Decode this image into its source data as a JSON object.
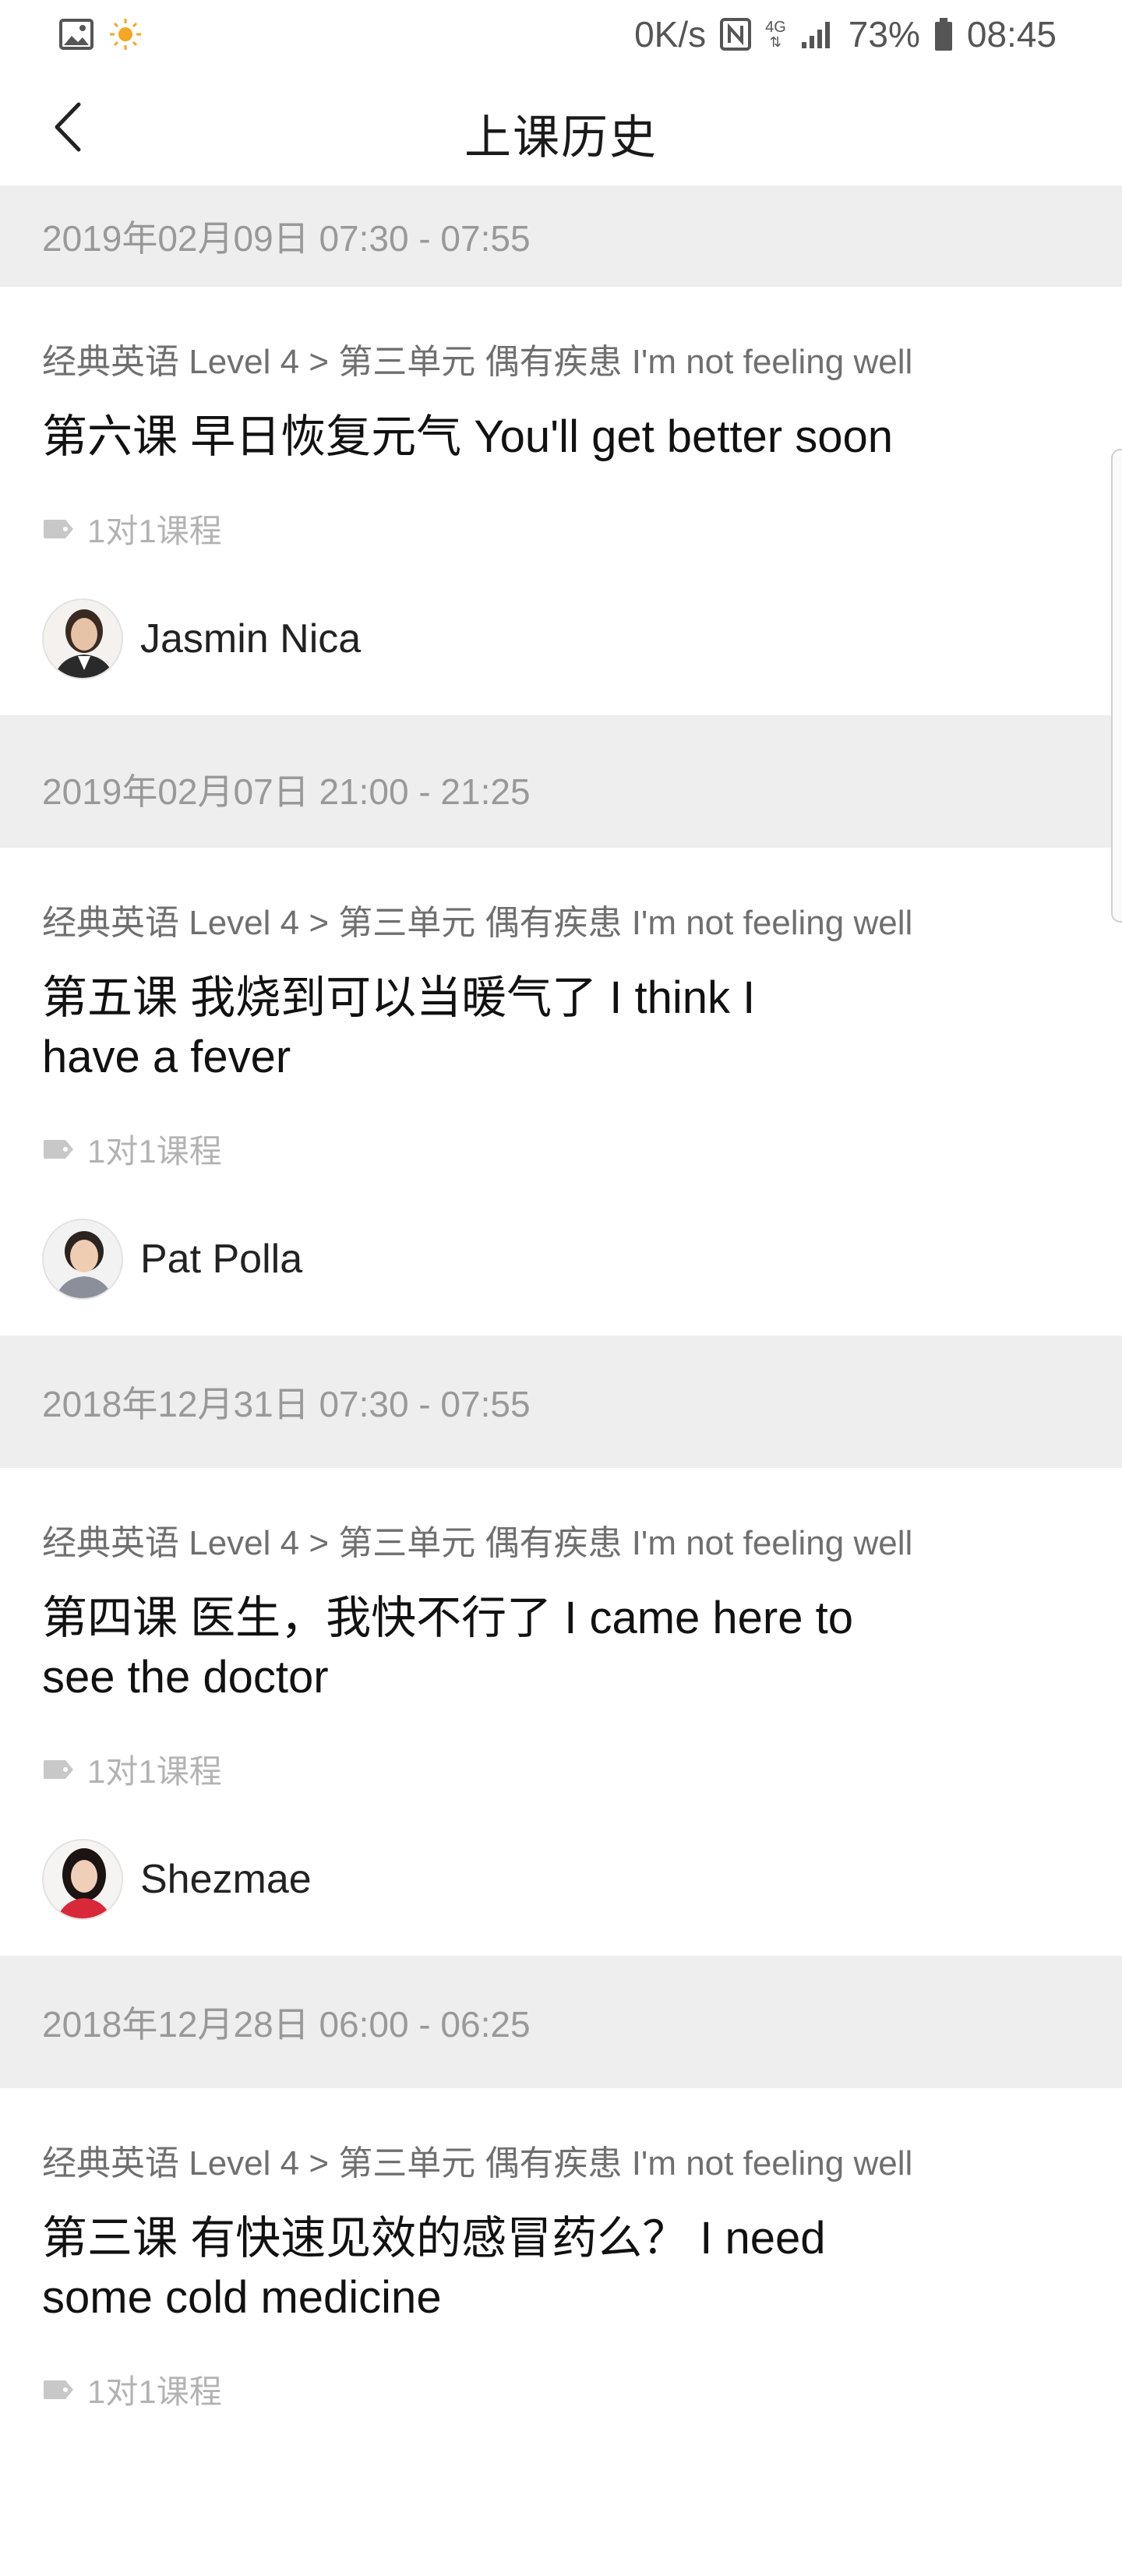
{
  "status_bar": {
    "net_speed": "0K/s",
    "network": "4G",
    "battery": "73%",
    "time": "08:45"
  },
  "header": {
    "title": "上课历史"
  },
  "sessions": [
    {
      "date": "2019年02月09日 07:30 - 07:55",
      "breadcrumb": "经典英语 Level 4 > 第三单元 偶有疾患 I'm not feeling well",
      "lesson_line1": "第六课 早日恢复元气 You'll get better soon",
      "lesson_line2": "",
      "tag": "1对1课程",
      "teacher": "Jasmin Nica"
    },
    {
      "date": "2019年02月07日 21:00 - 21:25",
      "breadcrumb": "经典英语 Level 4 > 第三单元 偶有疾患 I'm not feeling well",
      "lesson_line1": "第五课 我烧到可以当暖气了 I think I",
      "lesson_line2": "have a fever",
      "tag": "1对1课程",
      "teacher": "Pat Polla"
    },
    {
      "date": "2018年12月31日 07:30 - 07:55",
      "breadcrumb": "经典英语 Level 4 > 第三单元 偶有疾患 I'm not feeling well",
      "lesson_line1": "第四课 医生，我快不行了 I came here to",
      "lesson_line2": "see the doctor",
      "tag": "1对1课程",
      "teacher": "Shezmae"
    },
    {
      "date": "2018年12月28日 06:00 - 06:25",
      "breadcrumb": "经典英语 Level 4 > 第三单元 偶有疾患 I'm not feeling well",
      "lesson_line1": "第三课 有快速见效的感冒药么？ I need",
      "lesson_line2": "some cold medicine",
      "tag": "1对1课程",
      "teacher": ""
    }
  ]
}
